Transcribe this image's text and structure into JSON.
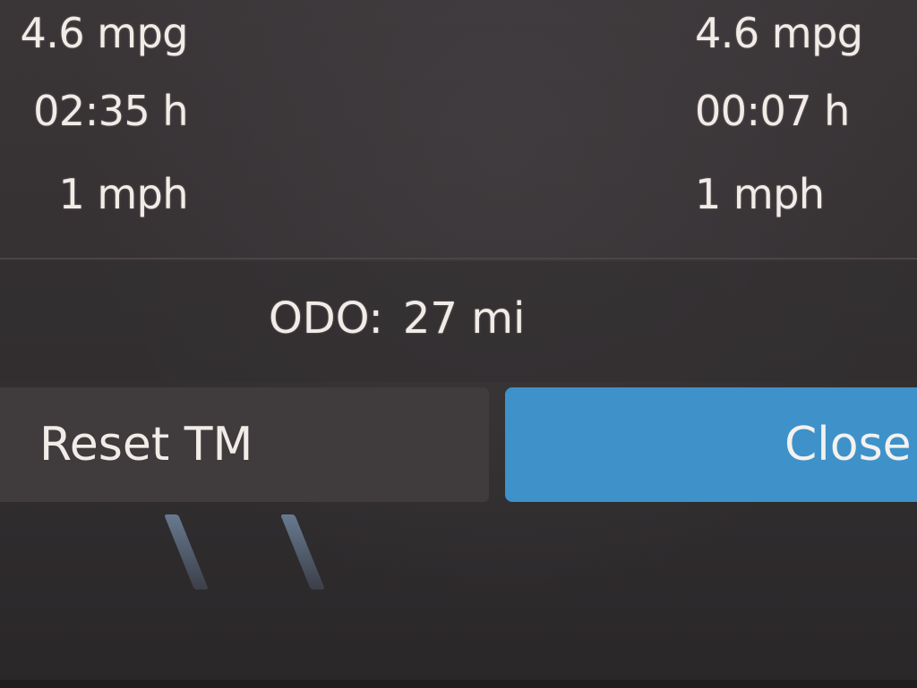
{
  "trip_left": {
    "economy": "4.6 mpg",
    "time": "02:35 h",
    "speed": "1 mph"
  },
  "trip_right": {
    "economy": "4.6 mpg",
    "time": "00:07 h",
    "speed": "1 mph"
  },
  "odometer": {
    "label": "ODO:",
    "value": "27 mi"
  },
  "buttons": {
    "reset_label": "Reset TM",
    "close_label": "Close"
  },
  "colors": {
    "close_button": "#3e92c9",
    "reset_button": "#403c3e",
    "background": "#353133",
    "text": "#f1ece7"
  },
  "icons": {
    "decorative_marks": "road-lane-icon"
  }
}
